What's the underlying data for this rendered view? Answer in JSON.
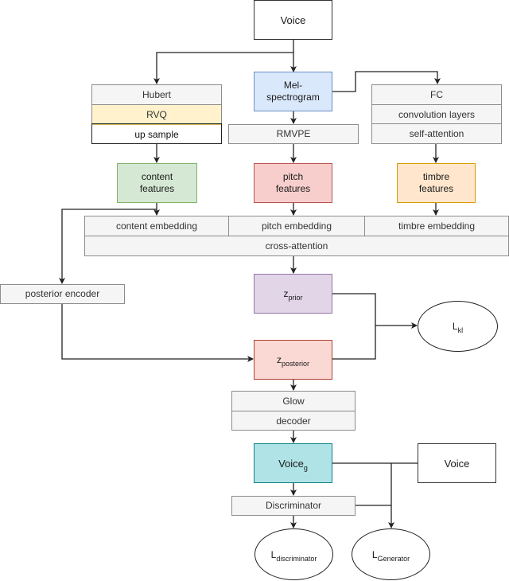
{
  "nodes": {
    "voice_input": "Voice",
    "mel": "Mel-spectrogram",
    "mel_line1": "Mel-",
    "mel_line2": "spectrogram",
    "hubert_stack": [
      "Hubert",
      "RVQ",
      "up sample"
    ],
    "rmvpe": "RMVPE",
    "timbre_stack": [
      "FC",
      "convolution layers",
      "self-attention"
    ],
    "content_features": [
      "content",
      "features"
    ],
    "pitch_features": [
      "pitch",
      "features"
    ],
    "timbre_features": [
      "timbre",
      "features"
    ],
    "embeddings": [
      "content embedding",
      "pitch embedding",
      "timbre embedding"
    ],
    "cross_attention": "cross-attention",
    "posterior_encoder": "posterior encoder",
    "z_prior": {
      "base": "z",
      "sub": "prior"
    },
    "z_posterior": {
      "base": "z",
      "sub": "posterior"
    },
    "l_kl": {
      "base": "L",
      "sub": "kl"
    },
    "glow_stack": [
      "Glow",
      "decoder"
    ],
    "voice_g": {
      "base": "Voice",
      "sub": "g"
    },
    "voice_ref": "Voice",
    "discriminator": "Discriminator",
    "l_discriminator": {
      "base": "L",
      "sub": "discriminator"
    },
    "l_generator": {
      "base": "L",
      "sub": "Generator"
    }
  },
  "colors": {
    "mel_fill": "#dae8fc",
    "mel_border": "#6c8ebf",
    "rvq_fill": "#fff2cc",
    "rvq_border": "#d6b656",
    "content_fill": "#d5e8d4",
    "content_border": "#82b366",
    "pitch_fill": "#f8cecc",
    "pitch_border": "#b85450",
    "timbre_fill": "#ffe6cc",
    "timbre_border": "#d79b00",
    "prior_fill": "#e1d5e7",
    "prior_border": "#9673a6",
    "posterior_fill": "#fad9d5",
    "posterior_border": "#ae4132",
    "voiceg_fill": "#b0e3e6",
    "voiceg_border": "#0e8088"
  }
}
